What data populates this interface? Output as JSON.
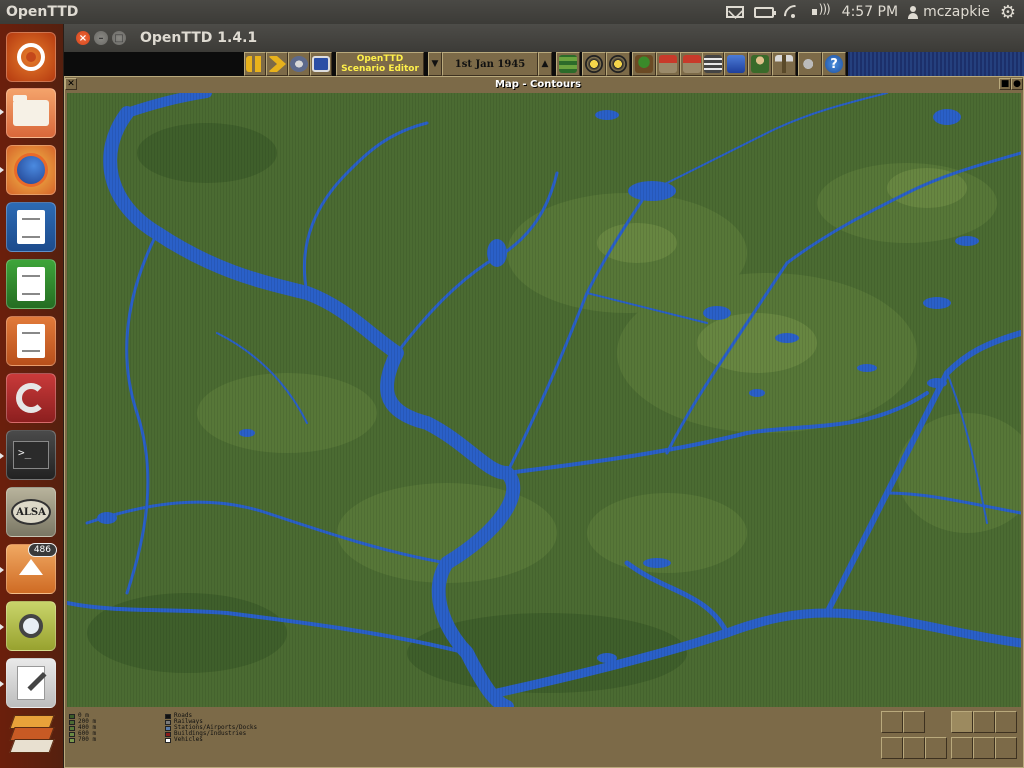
{
  "top_panel": {
    "app_title": "OpenTTD",
    "clock": "4:57 PM",
    "user": "mczapkie",
    "indicator_icons": [
      "mail-icon",
      "battery-icon",
      "wifi-icon",
      "volume-icon",
      "user-icon",
      "session-gear-icon"
    ]
  },
  "launcher": {
    "update_badge": "486",
    "alsa_label": "ALSA",
    "terminal_prompt": ">_",
    "items": [
      "ubuntu-dash",
      "files",
      "firefox",
      "libreoffice-writer",
      "libreoffice-calc",
      "libreoffice-impress",
      "system-settings",
      "terminal",
      "alsa-mixer",
      "update-manager",
      "image-viewer",
      "text-editor",
      "openttd"
    ]
  },
  "window": {
    "title": "OpenTTD 1.4.1"
  },
  "toolbar": {
    "scenario_editor_line1": "OpenTTD",
    "scenario_editor_line2": "Scenario Editor",
    "date": "1st Jan 1945",
    "date_up": "▲",
    "date_down": "▼",
    "help_glyph": "?"
  },
  "map_window": {
    "title": "Map - Contours",
    "close_glyph": "✕",
    "shade_glyph": "■",
    "sticky_glyph": "●"
  },
  "legend": {
    "contours": [
      {
        "label": "0 m",
        "color": "#3a5a28"
      },
      {
        "label": "200 m",
        "color": "#4b6b32"
      },
      {
        "label": "400 m",
        "color": "#5a7a3a"
      },
      {
        "label": "600 m",
        "color": "#6b8a44"
      },
      {
        "label": "700 m",
        "color": "#7c9a4e"
      }
    ],
    "features": [
      {
        "label": "Roads",
        "color": "#111111"
      },
      {
        "label": "Railways",
        "color": "#7a7a7a"
      },
      {
        "label": "Stations/Airports/Docks",
        "color": "#5a7aa8"
      },
      {
        "label": "Buildings/Industries",
        "color": "#8a1a1a"
      },
      {
        "label": "Vehicles",
        "color": "#ffffff"
      }
    ]
  },
  "colors": {
    "water": "#2a60c8",
    "land": "#4b6b32",
    "ttd_brown": "#7c6a48",
    "ubuntu_orange": "#dd4814"
  }
}
